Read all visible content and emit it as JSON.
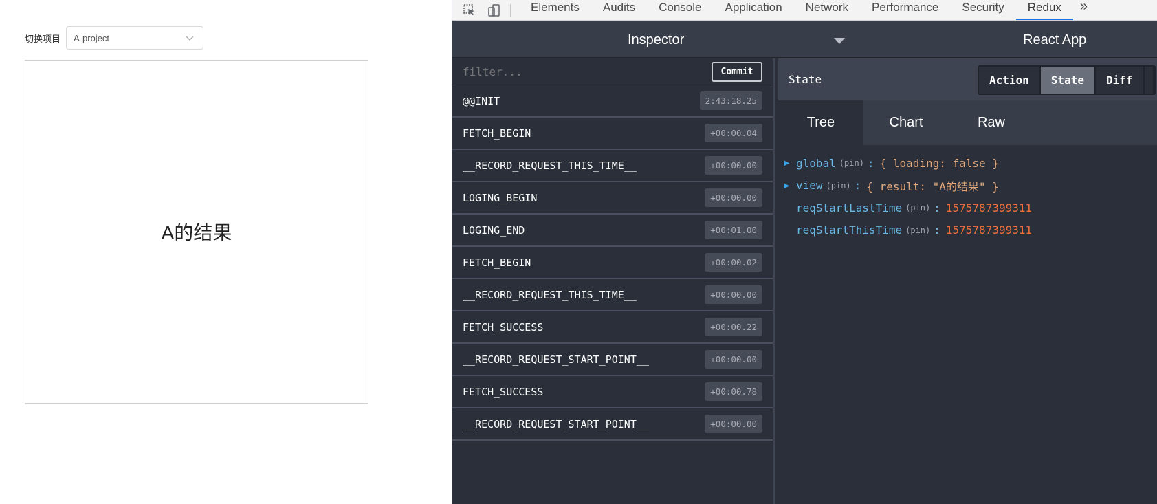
{
  "app": {
    "switch_label": "切换项目",
    "project_select": {
      "value": "A-project"
    },
    "result_text": "A的结果"
  },
  "devtools": {
    "tabs": [
      "Elements",
      "Audits",
      "Console",
      "Application",
      "Network",
      "Performance",
      "Security",
      "Redux"
    ],
    "active_tab": "Redux",
    "more_label": "»"
  },
  "redux": {
    "monitor_label": "Inspector",
    "instance_label": "React App",
    "filter_placeholder": "filter...",
    "commit_label": "Commit",
    "actions": [
      {
        "name": "@@INIT",
        "time": "2:43:18.25"
      },
      {
        "name": "FETCH_BEGIN",
        "time": "+00:00.04"
      },
      {
        "name": "__RECORD_REQUEST_THIS_TIME__",
        "time": "+00:00.00"
      },
      {
        "name": "LOGING_BEGIN",
        "time": "+00:00.00"
      },
      {
        "name": "LOGING_END",
        "time": "+00:01.00"
      },
      {
        "name": "FETCH_BEGIN",
        "time": "+00:00.02"
      },
      {
        "name": "__RECORD_REQUEST_THIS_TIME__",
        "time": "+00:00.00"
      },
      {
        "name": "FETCH_SUCCESS",
        "time": "+00:00.22"
      },
      {
        "name": "__RECORD_REQUEST_START_POINT__",
        "time": "+00:00.00"
      },
      {
        "name": "FETCH_SUCCESS",
        "time": "+00:00.78"
      },
      {
        "name": "__RECORD_REQUEST_START_POINT__",
        "time": "+00:00.00"
      }
    ],
    "state_title": "State",
    "segment_buttons": [
      "Action",
      "State",
      "Diff"
    ],
    "active_segment": "State",
    "view_tabs": [
      "Tree",
      "Chart",
      "Raw"
    ],
    "active_view": "Tree",
    "tree": [
      {
        "key": "global",
        "pin": "(pin)",
        "value": "{ loading: false }",
        "expandable": true,
        "kind": "object"
      },
      {
        "key": "view",
        "pin": "(pin)",
        "value": "{ result: \"A的结果\" }",
        "expandable": true,
        "kind": "object"
      },
      {
        "key": "reqStartLastTime",
        "pin": "(pin)",
        "value": "1575787399311",
        "expandable": false,
        "kind": "number"
      },
      {
        "key": "reqStartThisTime",
        "pin": "(pin)",
        "value": "1575787399311",
        "expandable": false,
        "kind": "number"
      }
    ]
  },
  "colors": {
    "devtools_bg": "#2a2f3a",
    "header_bg": "#373d49",
    "active_tab_underline": "#1a73e8",
    "tree_key": "#6ab8e5",
    "tree_number": "#f0703c",
    "tree_preview": "#e3a87b"
  }
}
